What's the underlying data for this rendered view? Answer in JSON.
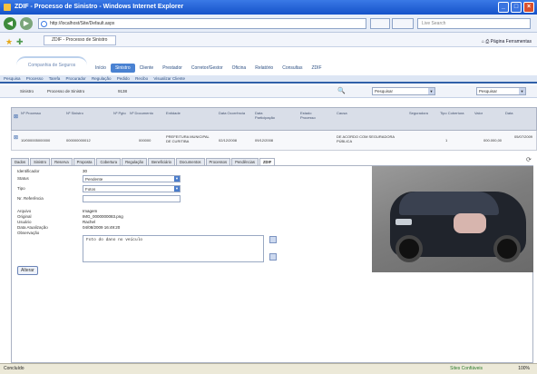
{
  "window": {
    "title": "ZDIF - Processo de Sinistro - Windows Internet Explorer"
  },
  "browser": {
    "url": "http://localhost/Site/Default.aspx",
    "search_placeholder": "Live Search",
    "tab_label": "ZDIF - Processo de Sinistro",
    "tools": [
      "Página",
      "Ferramentas"
    ]
  },
  "app": {
    "logo_text": "Companhia de Seguros",
    "nav": [
      "Início",
      "Sinistro",
      "Cliente",
      "Prestador",
      "Corretor/Gestor",
      "Oficina",
      "Relatório",
      "Consultas",
      "ZDIF"
    ],
    "subnav": [
      "Pesquisa",
      "Processo",
      "Tarefa",
      "Procurador",
      "Regulação",
      "Pedido",
      "Recibo",
      "Visualizar Cliente"
    ]
  },
  "filter": {
    "label": "Sinistro",
    "value": "Processo de Sinistro",
    "id": "9138",
    "select1": "Pesquisar",
    "select2": "Pesquisar"
  },
  "grid": {
    "headers": [
      "Nº Processo",
      "Nº Sinistro",
      "Nº Pgto",
      "Nº Documento",
      "Entidade",
      "Data Ocorrência",
      "Data Participação",
      "Estado Processo",
      "Causa",
      "Seguradora",
      "Tipo Cobertura",
      "Valor",
      "Data"
    ],
    "row": {
      "processo": "10/000005000000",
      "sinistro": "000000000012",
      "pgto": "",
      "documento": "000000",
      "entidade": "PREFEITURA MUNICIPAL DE CURITIBA",
      "ocorrencia": "02/12/2008",
      "participacao": "09/12/2008",
      "estado": "",
      "causa": "DE ACORDO COM SEGURADORA PÚBLICA",
      "seguradora": "1",
      "valor": "000.000,00",
      "data": "05/07/2009"
    }
  },
  "tabs": [
    "Dados",
    "Sinistro",
    "Reserva",
    "Proposta",
    "Cobertura",
    "Regulação",
    "Beneficiário",
    "Documentos",
    "Processos",
    "Pendências",
    "ZDIF"
  ],
  "active_tab": "ZDIF",
  "form": {
    "identificador_label": "Identificador",
    "identificador_value": "30",
    "status_label": "Status",
    "status_value": "Pendente",
    "tipo_label": "Tipo",
    "tipo_value": "Fotos",
    "referencia_label": "Nr. Referência",
    "arquivo_label": "Arquivo",
    "arquivo_value": "Imagem",
    "original_label": "Original",
    "original_value": "IMG_0000000083.png",
    "usuario_label": "Usuário",
    "usuario_value": "Rachel",
    "data_label": "Data Atualização",
    "data_value": "04/08/2009 16:49:20",
    "obs_label": "Observação",
    "obs_value": "Foto do dano no veículo",
    "button": "Alterar"
  },
  "status": {
    "text": "Concluído",
    "zone": "Sites Confiáveis",
    "zoom": "100%"
  }
}
